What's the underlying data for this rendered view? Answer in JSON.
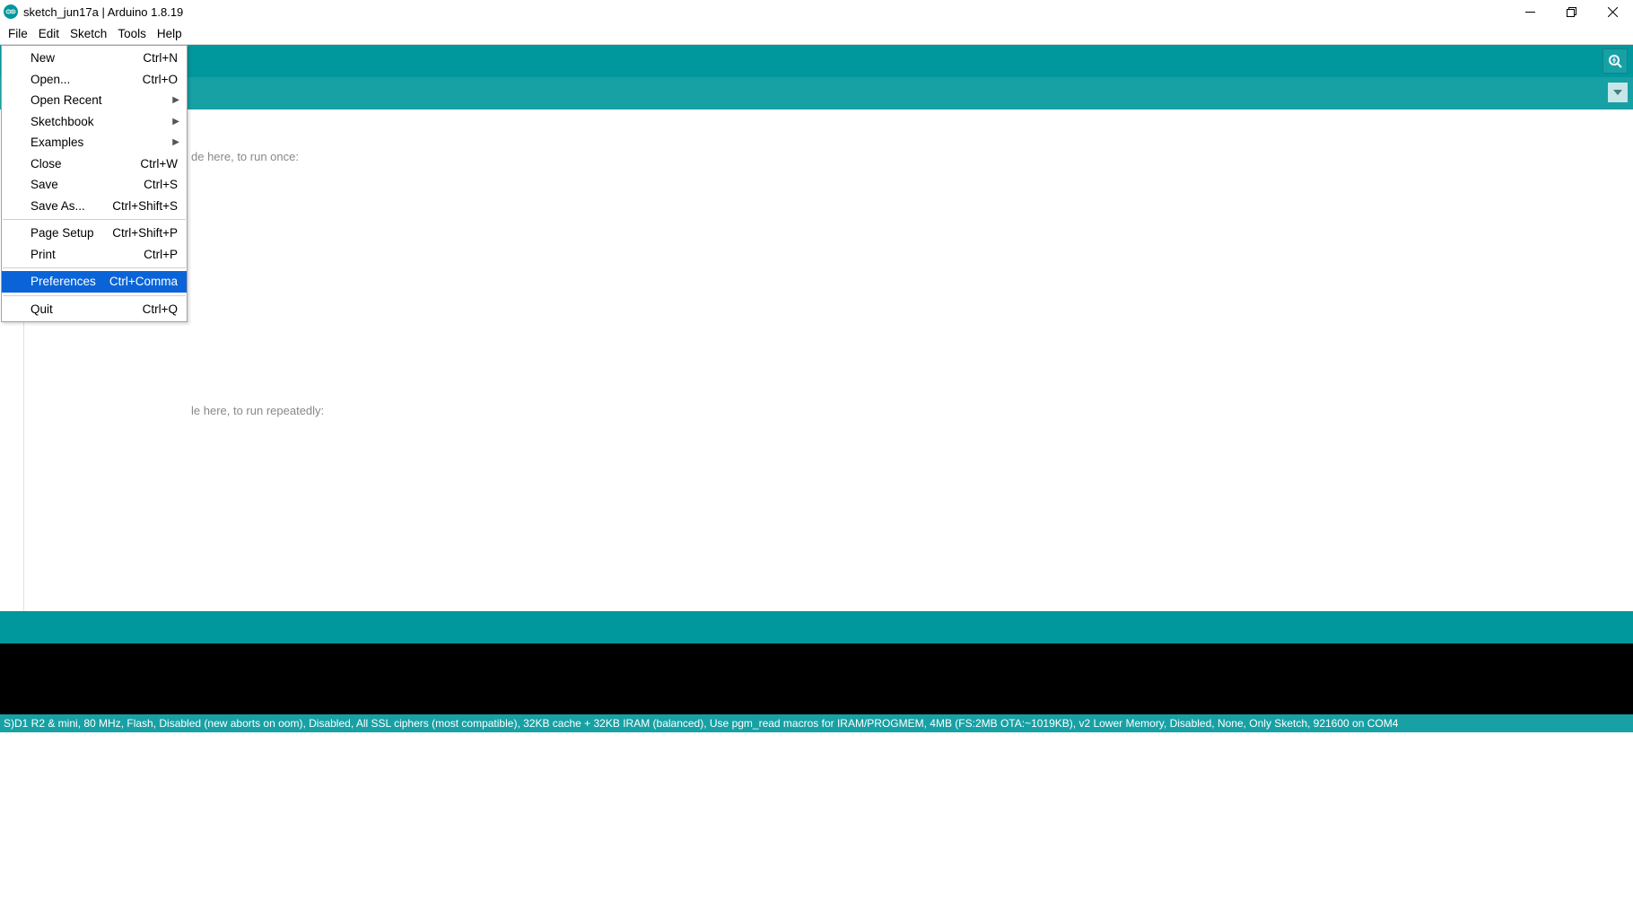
{
  "window": {
    "title": "sketch_jun17a | Arduino 1.8.19"
  },
  "menubar": {
    "items": [
      {
        "label": "File"
      },
      {
        "label": "Edit"
      },
      {
        "label": "Sketch"
      },
      {
        "label": "Tools"
      },
      {
        "label": "Help"
      }
    ]
  },
  "file_menu": {
    "groups": [
      [
        {
          "label": "New",
          "shortcut": "Ctrl+N",
          "submenu": false,
          "highlighted": false
        },
        {
          "label": "Open...",
          "shortcut": "Ctrl+O",
          "submenu": false,
          "highlighted": false
        },
        {
          "label": "Open Recent",
          "shortcut": "",
          "submenu": true,
          "highlighted": false
        },
        {
          "label": "Sketchbook",
          "shortcut": "",
          "submenu": true,
          "highlighted": false
        },
        {
          "label": "Examples",
          "shortcut": "",
          "submenu": true,
          "highlighted": false
        },
        {
          "label": "Close",
          "shortcut": "Ctrl+W",
          "submenu": false,
          "highlighted": false
        },
        {
          "label": "Save",
          "shortcut": "Ctrl+S",
          "submenu": false,
          "highlighted": false
        },
        {
          "label": "Save As...",
          "shortcut": "Ctrl+Shift+S",
          "submenu": false,
          "highlighted": false
        }
      ],
      [
        {
          "label": "Page Setup",
          "shortcut": "Ctrl+Shift+P",
          "submenu": false,
          "highlighted": false
        },
        {
          "label": "Print",
          "shortcut": "Ctrl+P",
          "submenu": false,
          "highlighted": false
        }
      ],
      [
        {
          "label": "Preferences",
          "shortcut": "Ctrl+Comma",
          "submenu": false,
          "highlighted": true
        }
      ],
      [
        {
          "label": "Quit",
          "shortcut": "Ctrl+Q",
          "submenu": false,
          "highlighted": false
        }
      ]
    ]
  },
  "code": {
    "line1": "de here, to run once:",
    "line2": "le here, to run repeatedly:"
  },
  "statusbar": {
    "text": "S)D1 R2 & mini, 80 MHz, Flash, Disabled (new aborts on oom), Disabled, All SSL ciphers (most compatible), 32KB cache + 32KB IRAM (balanced), Use pgm_read macros for IRAM/PROGMEM, 4MB (FS:2MB OTA:~1019KB), v2 Lower Memory, Disabled, None, Only Sketch, 921600 on COM4"
  },
  "icons": {
    "serial": "serial-monitor-icon",
    "tabmenu": "chevron-down-icon"
  }
}
